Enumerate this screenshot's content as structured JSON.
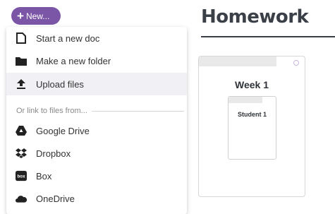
{
  "new_button": {
    "label": "New..."
  },
  "page": {
    "title": "Homework"
  },
  "menu": {
    "create_items": [
      {
        "label": "Start a new doc",
        "icon": "doc-icon"
      },
      {
        "label": "Make a new folder",
        "icon": "folder-icon"
      },
      {
        "label": "Upload files",
        "icon": "upload-icon",
        "highlighted": true
      }
    ],
    "section_label": "Or link to files from...",
    "link_items": [
      {
        "label": "Google Drive",
        "icon": "google-drive-icon"
      },
      {
        "label": "Dropbox",
        "icon": "dropbox-icon"
      },
      {
        "label": "Box",
        "icon": "box-icon"
      },
      {
        "label": "OneDrive",
        "icon": "onedrive-icon"
      }
    ]
  },
  "folder": {
    "name": "Week 1",
    "subfolder": {
      "name": "Student 1"
    }
  },
  "colors": {
    "accent": "#7b56a6",
    "title": "#3b3f47",
    "highlight": "#f1f1f5"
  }
}
